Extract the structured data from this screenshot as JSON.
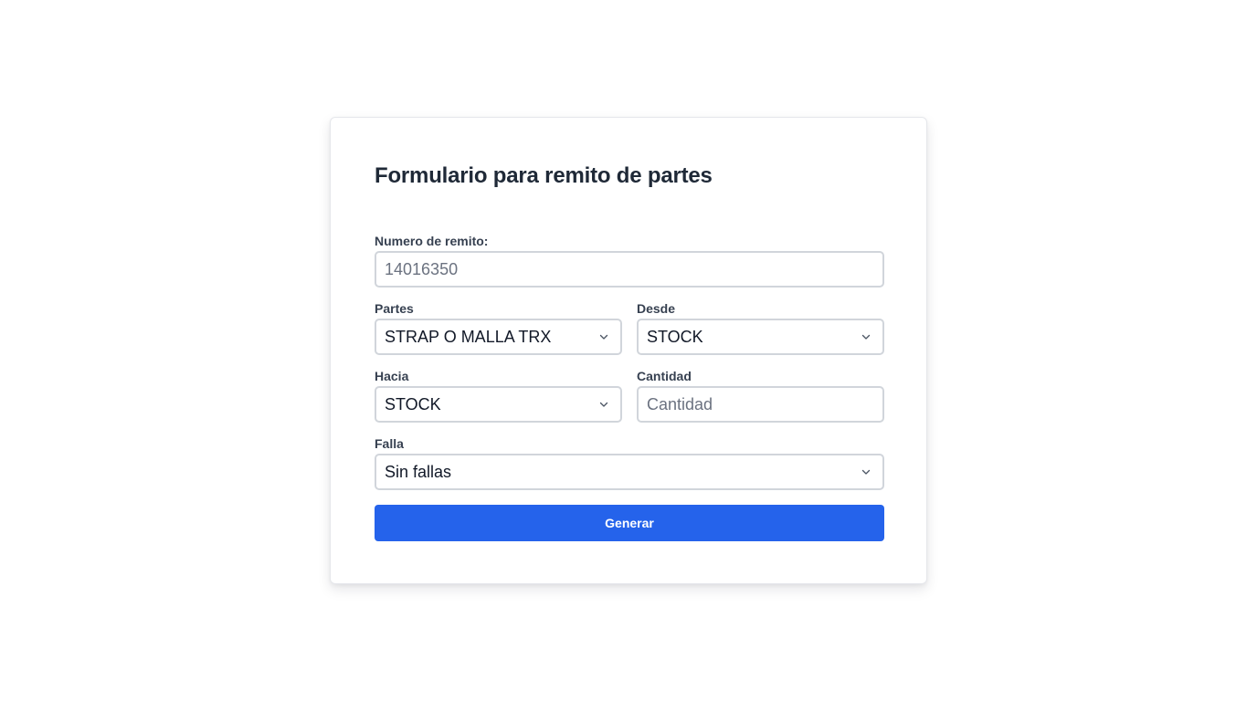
{
  "form": {
    "title": "Formulario para remito de partes",
    "numero_remito": {
      "label": "Numero de remito:",
      "placeholder": "14016350",
      "value": ""
    },
    "partes": {
      "label": "Partes",
      "selected": "STRAP O MALLA TRX"
    },
    "desde": {
      "label": "Desde",
      "selected": "STOCK"
    },
    "hacia": {
      "label": "Hacia",
      "selected": "STOCK"
    },
    "cantidad": {
      "label": "Cantidad",
      "placeholder": "Cantidad",
      "value": ""
    },
    "falla": {
      "label": "Falla",
      "selected": "Sin fallas"
    },
    "submit_label": "Generar"
  },
  "icons": {
    "select_arrow": "chevron-down-icon"
  },
  "colors": {
    "primary": "#2563eb",
    "title": "#1f2937",
    "label": "#374151",
    "border": "#d1d5db",
    "placeholder": "#6b7280"
  }
}
